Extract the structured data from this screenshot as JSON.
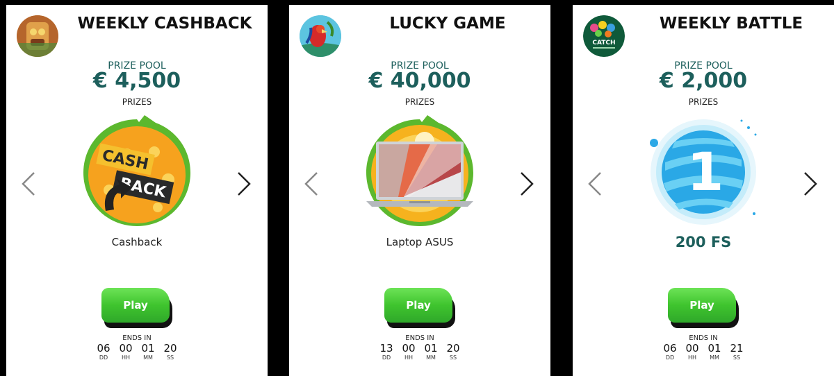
{
  "cards": [
    {
      "title": "WEEKLY CASHBACK",
      "pool_label": "PRIZE POOL",
      "pool_value": "€ 4,500",
      "prizes_label": "PRIZES",
      "prize_name": "Cashback",
      "art_text_1": "CASH",
      "art_text_2": "BACK",
      "play_label": "Play",
      "ends_label": "ENDS IN",
      "timer": [
        {
          "value": "06",
          "unit": "DD"
        },
        {
          "value": "00",
          "unit": "HH"
        },
        {
          "value": "01",
          "unit": "MM"
        },
        {
          "value": "20",
          "unit": "SS"
        }
      ]
    },
    {
      "title": "LUCKY GAME",
      "pool_label": "PRIZE POOL",
      "pool_value": "€ 40,000",
      "prizes_label": "PRIZES",
      "prize_name": "Laptop ASUS",
      "play_label": "Play",
      "ends_label": "ENDS IN",
      "timer": [
        {
          "value": "13",
          "unit": "DD"
        },
        {
          "value": "00",
          "unit": "HH"
        },
        {
          "value": "01",
          "unit": "MM"
        },
        {
          "value": "20",
          "unit": "SS"
        }
      ]
    },
    {
      "title": "WEEKLY BATTLE",
      "pool_label": "PRIZE POOL",
      "pool_value": "€ 2,000",
      "prizes_label": "PRIZES",
      "prize_name": "200 FS",
      "art_text_1": "1",
      "avatar_text": "CATCH",
      "play_label": "Play",
      "ends_label": "ENDS IN",
      "timer": [
        {
          "value": "06",
          "unit": "DD"
        },
        {
          "value": "00",
          "unit": "HH"
        },
        {
          "value": "01",
          "unit": "MM"
        },
        {
          "value": "21",
          "unit": "SS"
        }
      ]
    }
  ],
  "icons": {
    "prev": "chevron-left-icon",
    "next": "chevron-right-icon"
  },
  "colors": {
    "accent": "#1d5f5c",
    "play_green": "#3fc42e",
    "prize_ring": "#5cb82e"
  }
}
